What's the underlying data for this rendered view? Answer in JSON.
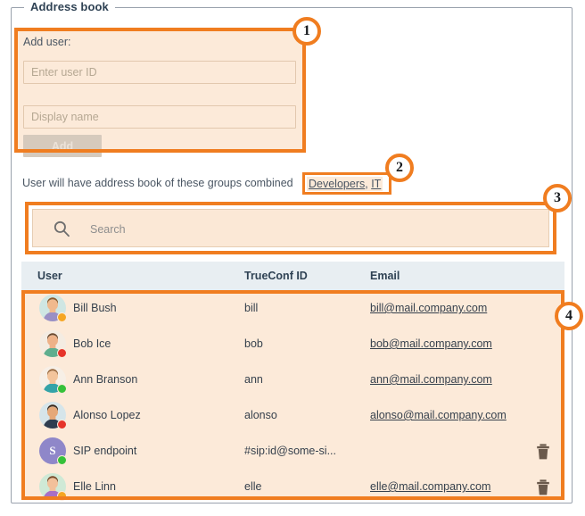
{
  "panel": {
    "legend": "Address book"
  },
  "add_user": {
    "label": "Add user:",
    "user_id_placeholder": "Enter user ID",
    "user_id_value": "",
    "display_name_placeholder": "Display name",
    "display_name_value": "",
    "add_label": "Add"
  },
  "groups_note": {
    "text": "User will have address book of these groups combined",
    "links": [
      {
        "label": "Developers"
      },
      {
        "label": "IT"
      }
    ],
    "separator": ", "
  },
  "search": {
    "placeholder": "Search",
    "value": "",
    "icon": "search-icon"
  },
  "table": {
    "columns": [
      "User",
      "TrueConf ID",
      "Email"
    ],
    "rows": [
      {
        "name": "Bill Bush",
        "trueconf_id": "bill",
        "email": "bill@mail.company.com",
        "status": "away",
        "status_color": "#f5a623",
        "avatar_type": "photo",
        "avatar_bg": "#cfe6e3",
        "skin": "#f0b98d",
        "hair": "#8c5a2b",
        "shirt": "#9a8fc4",
        "has_delete": false
      },
      {
        "name": "Bob Ice",
        "trueconf_id": "bob",
        "email": "bob@mail.company.com",
        "status": "busy",
        "status_color": "#e63329",
        "avatar_type": "photo",
        "avatar_bg": "#f4ece2",
        "skin": "#eeb288",
        "hair": "#6b4a2f",
        "shirt": "#5fae8e",
        "has_delete": false
      },
      {
        "name": "Ann Branson",
        "trueconf_id": "ann",
        "email": "ann@mail.company.com",
        "status": "online",
        "status_color": "#35c13a",
        "avatar_type": "photo",
        "avatar_bg": "#f7efe6",
        "skin": "#f3c49b",
        "hair": "#9c6b3f",
        "shirt": "#34a3a8",
        "has_delete": false
      },
      {
        "name": "Alonso Lopez",
        "trueconf_id": "alonso",
        "email": "alonso@mail.company.com",
        "status": "busy",
        "status_color": "#e63329",
        "avatar_type": "photo",
        "avatar_bg": "#d6e5ea",
        "skin": "#e5a878",
        "hair": "#3b2a1d",
        "shirt": "#2f3d4f",
        "has_delete": false
      },
      {
        "name": "SIP endpoint",
        "trueconf_id": "#sip:id@some-si...",
        "email": "",
        "status": "online",
        "status_color": "#35c13a",
        "avatar_type": "initial",
        "avatar_initial": "S",
        "avatar_bg": "#8f87c9",
        "has_delete": true
      },
      {
        "name": "Elle Linn",
        "trueconf_id": "elle",
        "email": "elle@mail.company.com",
        "status": "away",
        "status_color": "#f5a623",
        "avatar_type": "photo",
        "avatar_bg": "#cfe9d6",
        "skin": "#f2c09a",
        "hair": "#7a4a2a",
        "shirt": "#a86fc4",
        "has_delete": true
      }
    ]
  },
  "annotations": [
    {
      "number": "1"
    },
    {
      "number": "2"
    },
    {
      "number": "3"
    },
    {
      "number": "4"
    }
  ],
  "colors": {
    "accent": "#f07d20",
    "panel_bg": "#fcead9",
    "header_bg": "#e8eef2",
    "text": "#36414d"
  }
}
